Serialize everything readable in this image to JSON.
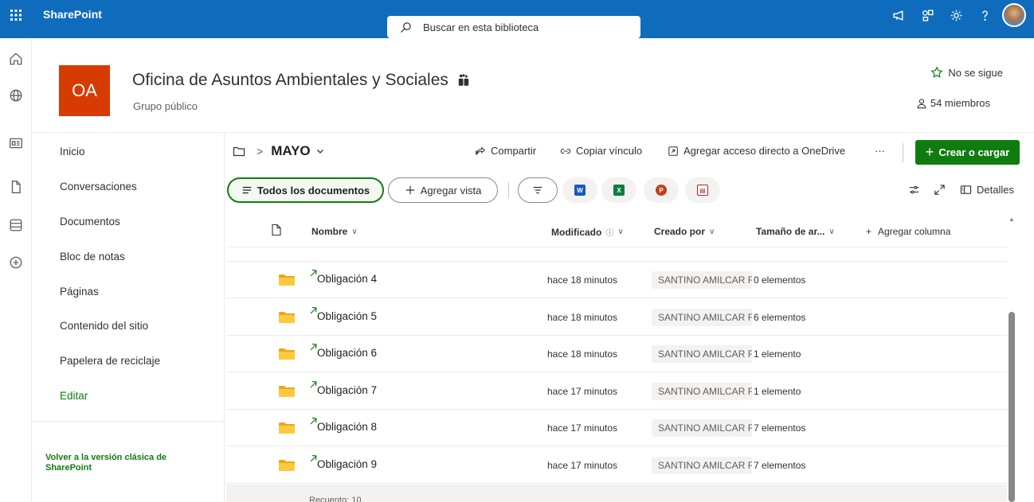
{
  "suitebar": {
    "app_name": "SharePoint",
    "search_placeholder": "Buscar en esta biblioteca"
  },
  "site": {
    "logo_text": "OA",
    "title": "Oficina de Asuntos Ambientales y Sociales",
    "subtitle": "Grupo público",
    "follow_label": "No se sigue",
    "members_label": "54 miembros"
  },
  "nav": {
    "items": [
      "Inicio",
      "Conversaciones",
      "Documentos",
      "Bloc de notas",
      "Páginas",
      "Contenido del sitio",
      "Papelera de reciclaje"
    ],
    "edit_label": "Editar",
    "classic_link": "Volver a la versión clásica de SharePoint"
  },
  "commandbar": {
    "folder": "MAYO",
    "share": "Compartir",
    "copy_link": "Copiar vínculo",
    "shortcut": "Agregar acceso directo a OneDrive",
    "more": "···",
    "create": "Crear o cargar"
  },
  "views": {
    "all_docs": "Todos los documentos",
    "add_view": "Agregar vista",
    "details": "Detalles"
  },
  "list": {
    "columns": {
      "name": "Nombre",
      "modified": "Modificado",
      "created_by": "Creado por",
      "size": "Tamaño de ar...",
      "add_column": "Agregar columna"
    },
    "rows": [
      {
        "name": "Obligación 4",
        "modified": "hace 18 minutos",
        "creator": "SANTINO AMILCAR FI",
        "size": "0 elementos"
      },
      {
        "name": "Obligación 5",
        "modified": "hace 18 minutos",
        "creator": "SANTINO AMILCAR FI",
        "size": "6 elementos"
      },
      {
        "name": "Obligación 6",
        "modified": "hace 18 minutos",
        "creator": "SANTINO AMILCAR FI",
        "size": "1 elemento"
      },
      {
        "name": "Obligación 7",
        "modified": "hace 17 minutos",
        "creator": "SANTINO AMILCAR FI",
        "size": "1 elemento"
      },
      {
        "name": "Obligación 8",
        "modified": "hace 17 minutos",
        "creator": "SANTINO AMILCAR FI",
        "size": "7 elementos"
      },
      {
        "name": "Obligación 9",
        "modified": "hace 17 minutos",
        "creator": "SANTINO AMILCAR FI",
        "size": "7 elementos"
      }
    ],
    "footer_text": "Recuento: 10"
  },
  "colors": {
    "suitebar": "#0f6cbd",
    "accent_green": "#107c10",
    "logo": "#d83b01",
    "folder": "#f4c430"
  }
}
